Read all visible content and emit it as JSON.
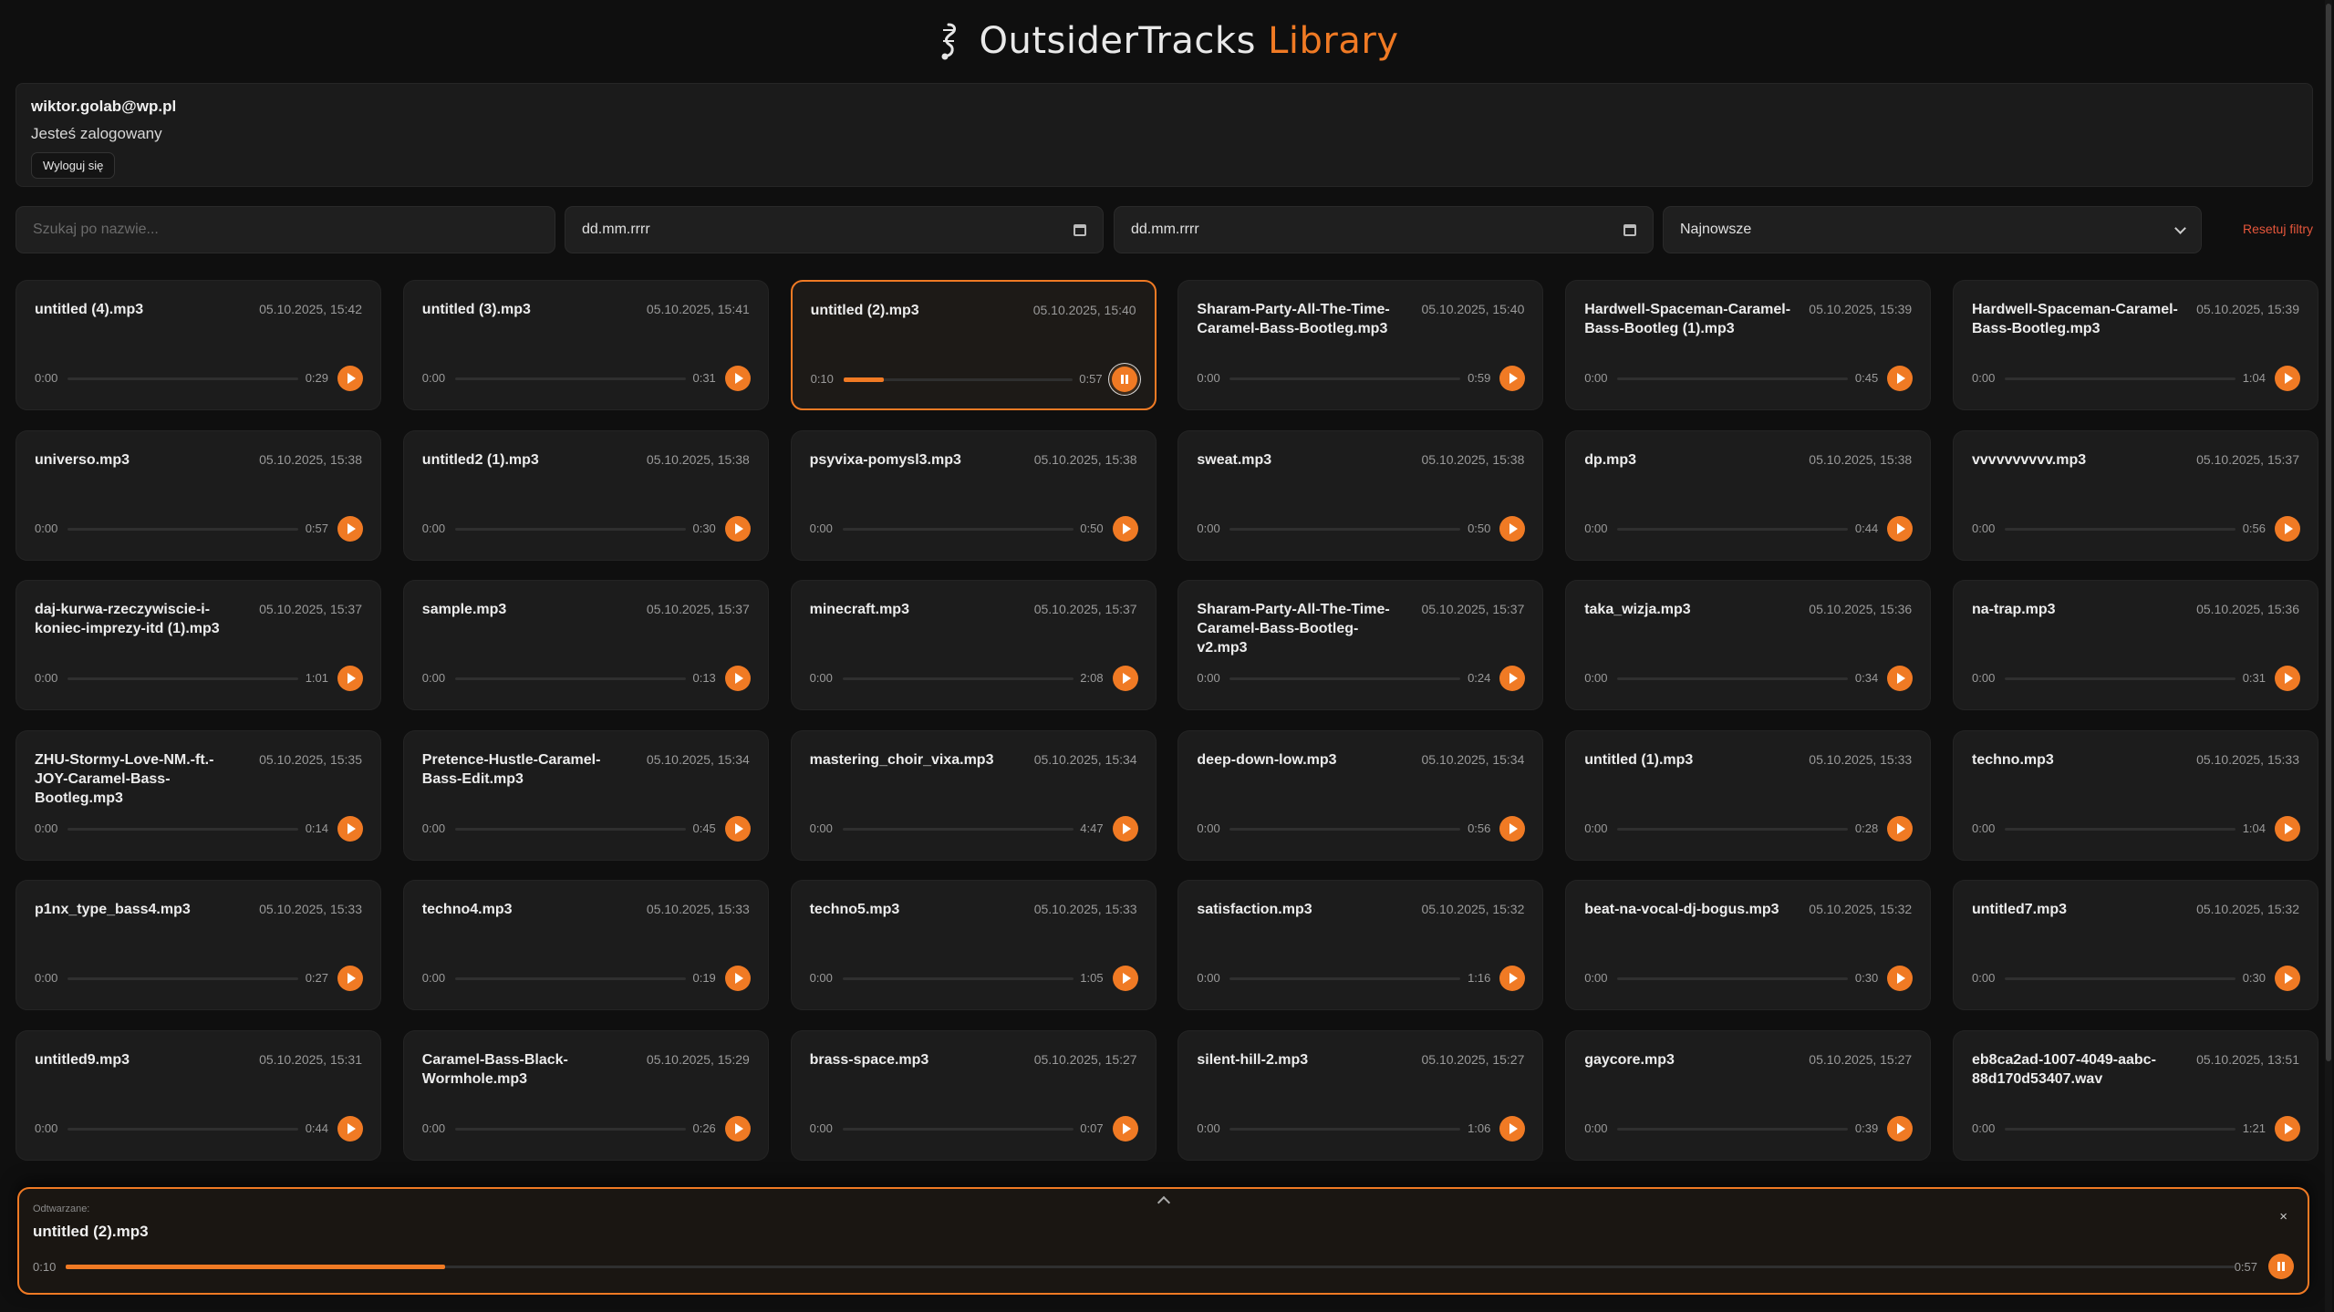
{
  "header": {
    "brand_main": "OutsiderTracks",
    "brand_accent": "Library",
    "logo_icon": "music-note-icon"
  },
  "user": {
    "email": "wiktor.golab@wp.pl",
    "status": "Jesteś zalogowany",
    "logout_label": "Wyloguj się"
  },
  "filters": {
    "search_placeholder": "Szukaj po nazwie...",
    "date_from": "dd.mm.rrrr",
    "date_to": "dd.mm.rrrr",
    "sort_selected": "Najnowsze",
    "reset_label": "Resetuj filtry"
  },
  "colors": {
    "accent": "#f07a24",
    "reset": "#e5563b",
    "background": "#0f0f0f",
    "card": "#1c1c1c"
  },
  "tracks": [
    {
      "name": "untitled (4).mp3",
      "date": "05.10.2025, 15:42",
      "current": "0:00",
      "duration": "0:29"
    },
    {
      "name": "untitled (3).mp3",
      "date": "05.10.2025, 15:41",
      "current": "0:00",
      "duration": "0:31"
    },
    {
      "name": "untitled (2).mp3",
      "date": "05.10.2025, 15:40",
      "current": "0:10",
      "duration": "0:57",
      "active": true,
      "progress": 0.175
    },
    {
      "name": "Sharam-Party-All-The-Time-Caramel-Bass-Bootleg.mp3",
      "date": "05.10.2025, 15:40",
      "current": "0:00",
      "duration": "0:59"
    },
    {
      "name": "Hardwell-Spaceman-Caramel-Bass-Bootleg (1).mp3",
      "date": "05.10.2025, 15:39",
      "current": "0:00",
      "duration": "0:45"
    },
    {
      "name": "Hardwell-Spaceman-Caramel-Bass-Bootleg.mp3",
      "date": "05.10.2025, 15:39",
      "current": "0:00",
      "duration": "1:04"
    },
    {
      "name": "universo.mp3",
      "date": "05.10.2025, 15:38",
      "current": "0:00",
      "duration": "0:57"
    },
    {
      "name": "untitled2 (1).mp3",
      "date": "05.10.2025, 15:38",
      "current": "0:00",
      "duration": "0:30"
    },
    {
      "name": "psyvixa-pomysl3.mp3",
      "date": "05.10.2025, 15:38",
      "current": "0:00",
      "duration": "0:50"
    },
    {
      "name": "sweat.mp3",
      "date": "05.10.2025, 15:38",
      "current": "0:00",
      "duration": "0:50"
    },
    {
      "name": "dp.mp3",
      "date": "05.10.2025, 15:38",
      "current": "0:00",
      "duration": "0:44"
    },
    {
      "name": "vvvvvvvvvv.mp3",
      "date": "05.10.2025, 15:37",
      "current": "0:00",
      "duration": "0:56"
    },
    {
      "name": "daj-kurwa-rzeczywiscie-i-koniec-imprezy-itd (1).mp3",
      "date": "05.10.2025, 15:37",
      "current": "0:00",
      "duration": "1:01"
    },
    {
      "name": "sample.mp3",
      "date": "05.10.2025, 15:37",
      "current": "0:00",
      "duration": "0:13"
    },
    {
      "name": "minecraft.mp3",
      "date": "05.10.2025, 15:37",
      "current": "0:00",
      "duration": "2:08"
    },
    {
      "name": "Sharam-Party-All-The-Time-Caramel-Bass-Bootleg-v2.mp3",
      "date": "05.10.2025, 15:37",
      "current": "0:00",
      "duration": "0:24"
    },
    {
      "name": "taka_wizja.mp3",
      "date": "05.10.2025, 15:36",
      "current": "0:00",
      "duration": "0:34"
    },
    {
      "name": "na-trap.mp3",
      "date": "05.10.2025, 15:36",
      "current": "0:00",
      "duration": "0:31"
    },
    {
      "name": "ZHU-Stormy-Love-NM.-ft.-JOY-Caramel-Bass-Bootleg.mp3",
      "date": "05.10.2025, 15:35",
      "current": "0:00",
      "duration": "0:14"
    },
    {
      "name": "Pretence-Hustle-Caramel-Bass-Edit.mp3",
      "date": "05.10.2025, 15:34",
      "current": "0:00",
      "duration": "0:45"
    },
    {
      "name": "mastering_choir_vixa.mp3",
      "date": "05.10.2025, 15:34",
      "current": "0:00",
      "duration": "4:47"
    },
    {
      "name": "deep-down-low.mp3",
      "date": "05.10.2025, 15:34",
      "current": "0:00",
      "duration": "0:56"
    },
    {
      "name": "untitled (1).mp3",
      "date": "05.10.2025, 15:33",
      "current": "0:00",
      "duration": "0:28"
    },
    {
      "name": "techno.mp3",
      "date": "05.10.2025, 15:33",
      "current": "0:00",
      "duration": "1:04"
    },
    {
      "name": "p1nx_type_bass4.mp3",
      "date": "05.10.2025, 15:33",
      "current": "0:00",
      "duration": "0:27"
    },
    {
      "name": "techno4.mp3",
      "date": "05.10.2025, 15:33",
      "current": "0:00",
      "duration": "0:19"
    },
    {
      "name": "techno5.mp3",
      "date": "05.10.2025, 15:33",
      "current": "0:00",
      "duration": "1:05"
    },
    {
      "name": "satisfaction.mp3",
      "date": "05.10.2025, 15:32",
      "current": "0:00",
      "duration": "1:16"
    },
    {
      "name": "beat-na-vocal-dj-bogus.mp3",
      "date": "05.10.2025, 15:32",
      "current": "0:00",
      "duration": "0:30"
    },
    {
      "name": "untitled7.mp3",
      "date": "05.10.2025, 15:32",
      "current": "0:00",
      "duration": "0:30"
    },
    {
      "name": "untitled9.mp3",
      "date": "05.10.2025, 15:31",
      "current": "0:00",
      "duration": "0:44"
    },
    {
      "name": "Caramel-Bass-Black-Wormhole.mp3",
      "date": "05.10.2025, 15:29",
      "current": "0:00",
      "duration": "0:26"
    },
    {
      "name": "brass-space.mp3",
      "date": "05.10.2025, 15:27",
      "current": "0:00",
      "duration": "0:07"
    },
    {
      "name": "silent-hill-2.mp3",
      "date": "05.10.2025, 15:27",
      "current": "0:00",
      "duration": "1:06"
    },
    {
      "name": "gaycore.mp3",
      "date": "05.10.2025, 15:27",
      "current": "0:00",
      "duration": "0:39"
    },
    {
      "name": "eb8ca2ad-1007-4049-aabc-88d170d53407.wav",
      "date": "05.10.2025, 13:51",
      "current": "0:00",
      "duration": "1:21"
    }
  ],
  "player": {
    "label": "Odtwarzane:",
    "title": "untitled (2).mp3",
    "current": "0:10",
    "duration": "0:57",
    "progress": 0.175,
    "close_symbol": "×"
  }
}
